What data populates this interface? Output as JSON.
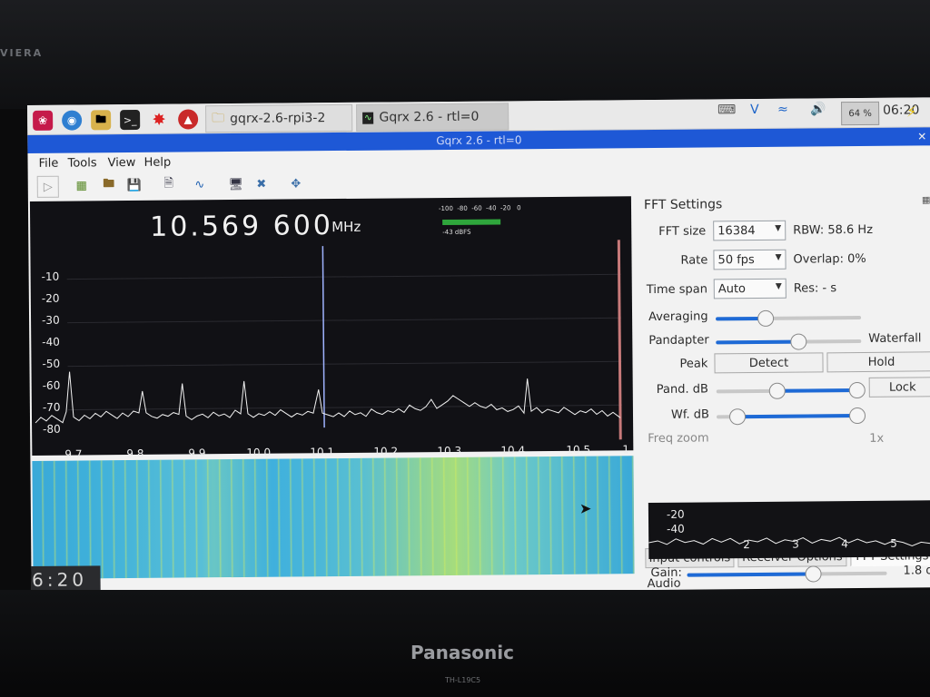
{
  "monitor": {
    "brand": "Panasonic",
    "model": "TH-L19C5",
    "bezel_text": "VIERA"
  },
  "taskbar": {
    "tasks": [
      {
        "label": "gqrx-2.6-rpi3-2",
        "icon": "folder-icon"
      },
      {
        "label": "Gqrx 2.6 - rtl=0",
        "icon": "scope-icon"
      }
    ],
    "cpu_label": "64 %",
    "clock": "06:20"
  },
  "window": {
    "title": "Gqrx 2.6 - rtl=0"
  },
  "menu": {
    "file": "File",
    "tools": "Tools",
    "view": "View",
    "help": "Help"
  },
  "plot": {
    "frequency": "10.569 600",
    "unit": "MHz",
    "meter_scale": "-100  -80  -60  -40  -20   0",
    "meter_reading": "-43 dBFS",
    "y_ticks": [
      "-10",
      "-20",
      "-30",
      "-40",
      "-50",
      "-60",
      "-70",
      "-80"
    ],
    "x_ticks": [
      "9.7",
      "9.8",
      "9.9",
      "10.0",
      "10.1",
      "10.2",
      "10.3",
      "10.4",
      "10.5",
      "1"
    ],
    "waterfall_clock": "6:20"
  },
  "fft": {
    "title": "FFT Settings",
    "fft_size_label": "FFT size",
    "fft_size": "16384",
    "rbw": "RBW: 58.6 Hz",
    "rate_label": "Rate",
    "rate": "50 fps",
    "overlap": "Overlap: 0%",
    "time_span_label": "Time span",
    "time_span": "Auto",
    "res": "Res: - s",
    "averaging_label": "Averaging",
    "pandapter_label": "Pandapter",
    "waterfall_label": "Waterfall",
    "peak_label": "Peak",
    "detect_btn": "Detect",
    "hold_btn": "Hold",
    "pand_db_label": "Pand. dB",
    "lock_btn": "Lock",
    "wf_db_label": "Wf. dB",
    "freq_zoom_label": "Freq zoom",
    "zoom_value": "1x"
  },
  "tabs": [
    "Input controls",
    "Receiver Options",
    "FFT Settings"
  ],
  "audio": {
    "title": "Audio",
    "y_ticks": [
      "-20",
      "-40"
    ],
    "x_ticks": [
      "2",
      "3",
      "4",
      "5"
    ],
    "gain_label": "Gain:",
    "gain_value": "1.8 d"
  }
}
